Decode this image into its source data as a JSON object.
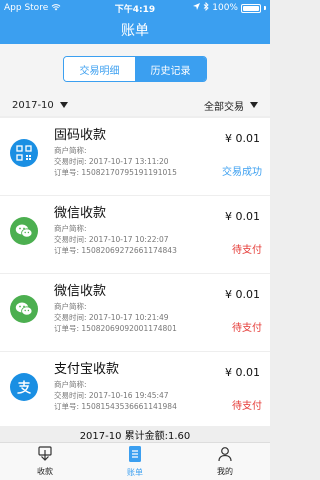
{
  "status_bar": {
    "carrier": "App Store",
    "time": "下午4:19",
    "battery": "100%",
    "battery_level": 1.0
  },
  "nav": {
    "title": "账单"
  },
  "segments": {
    "left": "交易明细",
    "right": "历史记录"
  },
  "filters": {
    "month": "2017-10",
    "type": "全部交易"
  },
  "transactions": [
    {
      "icon": "qr-code-icon",
      "title": "固码收款",
      "merchant": "商户简称:",
      "time": "交易时间: 2017-10-17 13:11:20",
      "order": "订单号: 15082170795191191015",
      "amount": "¥ 0.01",
      "status": "交易成功",
      "status_color": "#3b9ff0"
    },
    {
      "icon": "wechat-icon",
      "title": "微信收款",
      "merchant": "商户简称:",
      "time": "交易时间: 2017-10-17 10:22:07",
      "order": "订单号: 15082069272661174843",
      "amount": "¥ 0.01",
      "status": "待支付",
      "status_color": "#e53935"
    },
    {
      "icon": "wechat-icon",
      "title": "微信收款",
      "merchant": "商户简称:",
      "time": "交易时间: 2017-10-17 10:21:49",
      "order": "订单号: 15082069092001174801",
      "amount": "¥ 0.01",
      "status": "待支付",
      "status_color": "#e53935"
    },
    {
      "icon": "alipay-icon",
      "title": "支付宝收款",
      "merchant": "商户简称:",
      "time": "交易时间: 2017-10-16 19:45:47",
      "order": "订单号: 15081543536661141984",
      "amount": "¥ 0.01",
      "status": "待支付",
      "status_color": "#e53935"
    }
  ],
  "summary": {
    "text": "2017-10 累计金额:1.60"
  },
  "tabs": [
    {
      "label": "收款",
      "icon": "receive-money-icon",
      "active": false
    },
    {
      "label": "账单",
      "icon": "bill-icon",
      "active": true
    },
    {
      "label": "我的",
      "icon": "profile-icon",
      "active": false
    }
  ],
  "colors": {
    "primary": "#3b9ff0",
    "success": "#3b9ff0",
    "pending": "#e53935",
    "wechat": "#4caf50",
    "alipay": "#1a8fe3"
  }
}
